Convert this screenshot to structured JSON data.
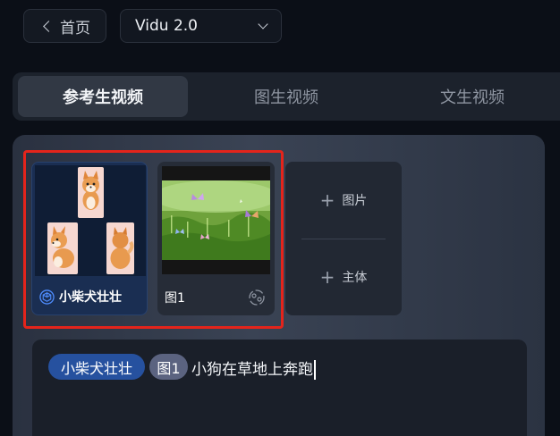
{
  "header": {
    "back_label": "首页",
    "model_value": "Vidu 2.0"
  },
  "tabs": [
    {
      "label": "参考生视频",
      "active": true
    },
    {
      "label": "图生视频",
      "active": false
    },
    {
      "label": "文生视频",
      "active": false
    }
  ],
  "references": {
    "subject_card": {
      "label": "小柴犬壮壮",
      "icon": "cube-icon"
    },
    "image_card": {
      "label": "图1",
      "icon": "sync-icon"
    },
    "add_image_label": "图片",
    "add_subject_label": "主体"
  },
  "prompt": {
    "subject_chip": "小柴犬壮壮",
    "image_chip": "图1",
    "text": "小狗在草地上奔跑"
  },
  "colors": {
    "highlight_border": "#e4241b",
    "subject_chip": "#26519f",
    "image_chip": "#5b6380"
  }
}
